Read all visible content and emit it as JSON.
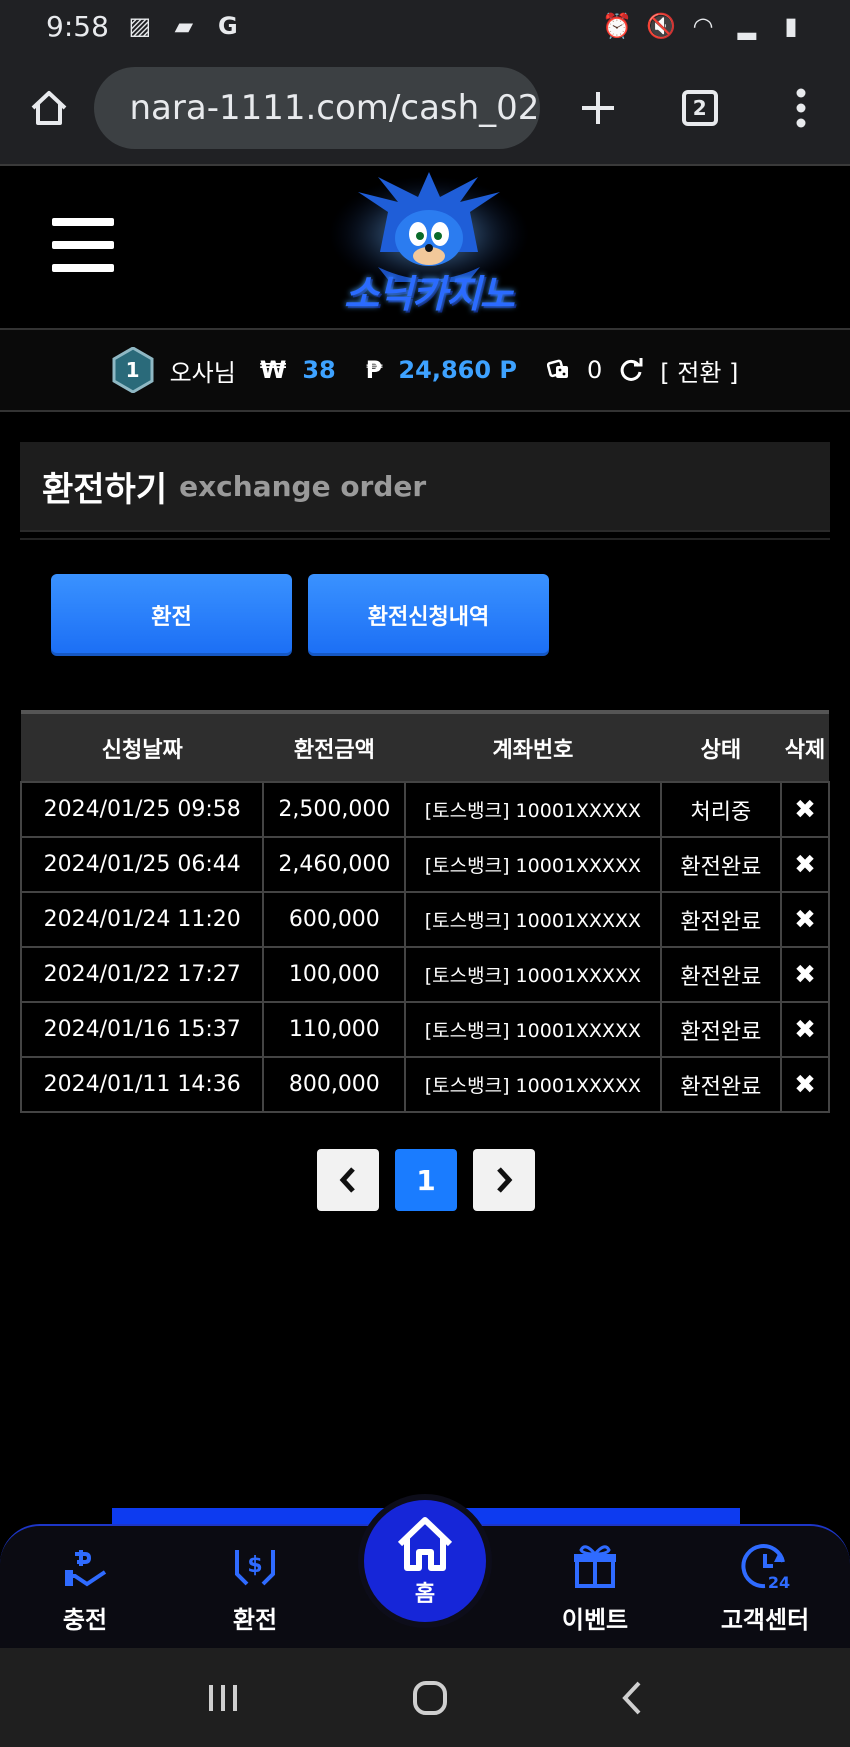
{
  "status_bar": {
    "time": "9:58"
  },
  "browser": {
    "url": "nara-1111.com/cash_02",
    "tab_count": "2"
  },
  "site": {
    "logo_text": "소닉카지노"
  },
  "user": {
    "level": "1",
    "name": "오사님",
    "cash_symbol": "₩",
    "cash": "38",
    "point_symbol": "₱",
    "points": "24,860 P",
    "casino_count": "0",
    "convert_label": "[ 전환 ]"
  },
  "panel": {
    "title_ko": "환전하기",
    "title_en": "exchange order"
  },
  "buttons": {
    "exchange": "환전",
    "history": "환전신청내역"
  },
  "table": {
    "headers": [
      "신청날짜",
      "환전금액",
      "계좌번호",
      "상태",
      "삭제"
    ],
    "rows": [
      {
        "date": "2024/01/25 09:58",
        "amount": "2,500,000",
        "account": "[토스뱅크] 10001XXXXX",
        "status": "처리중"
      },
      {
        "date": "2024/01/25 06:44",
        "amount": "2,460,000",
        "account": "[토스뱅크] 10001XXXXX",
        "status": "환전완료"
      },
      {
        "date": "2024/01/24 11:20",
        "amount": "600,000",
        "account": "[토스뱅크] 10001XXXXX",
        "status": "환전완료"
      },
      {
        "date": "2024/01/22 17:27",
        "amount": "100,000",
        "account": "[토스뱅크] 10001XXXXX",
        "status": "환전완료"
      },
      {
        "date": "2024/01/16 15:37",
        "amount": "110,000",
        "account": "[토스뱅크] 10001XXXXX",
        "status": "환전완료"
      },
      {
        "date": "2024/01/11 14:36",
        "amount": "800,000",
        "account": "[토스뱅크] 10001XXXXX",
        "status": "환전완료"
      }
    ],
    "delete_glyph": "✖"
  },
  "pagination": {
    "prev": "‹",
    "current": "1",
    "next": "›"
  },
  "bottom_nav": {
    "charge": "충전",
    "exchange": "환전",
    "home": "홈",
    "event": "이벤트",
    "support": "고객센터"
  },
  "colors": {
    "accent": "#3ea2ff",
    "button": "#1b6ef5",
    "nav_home": "#1626d8"
  }
}
